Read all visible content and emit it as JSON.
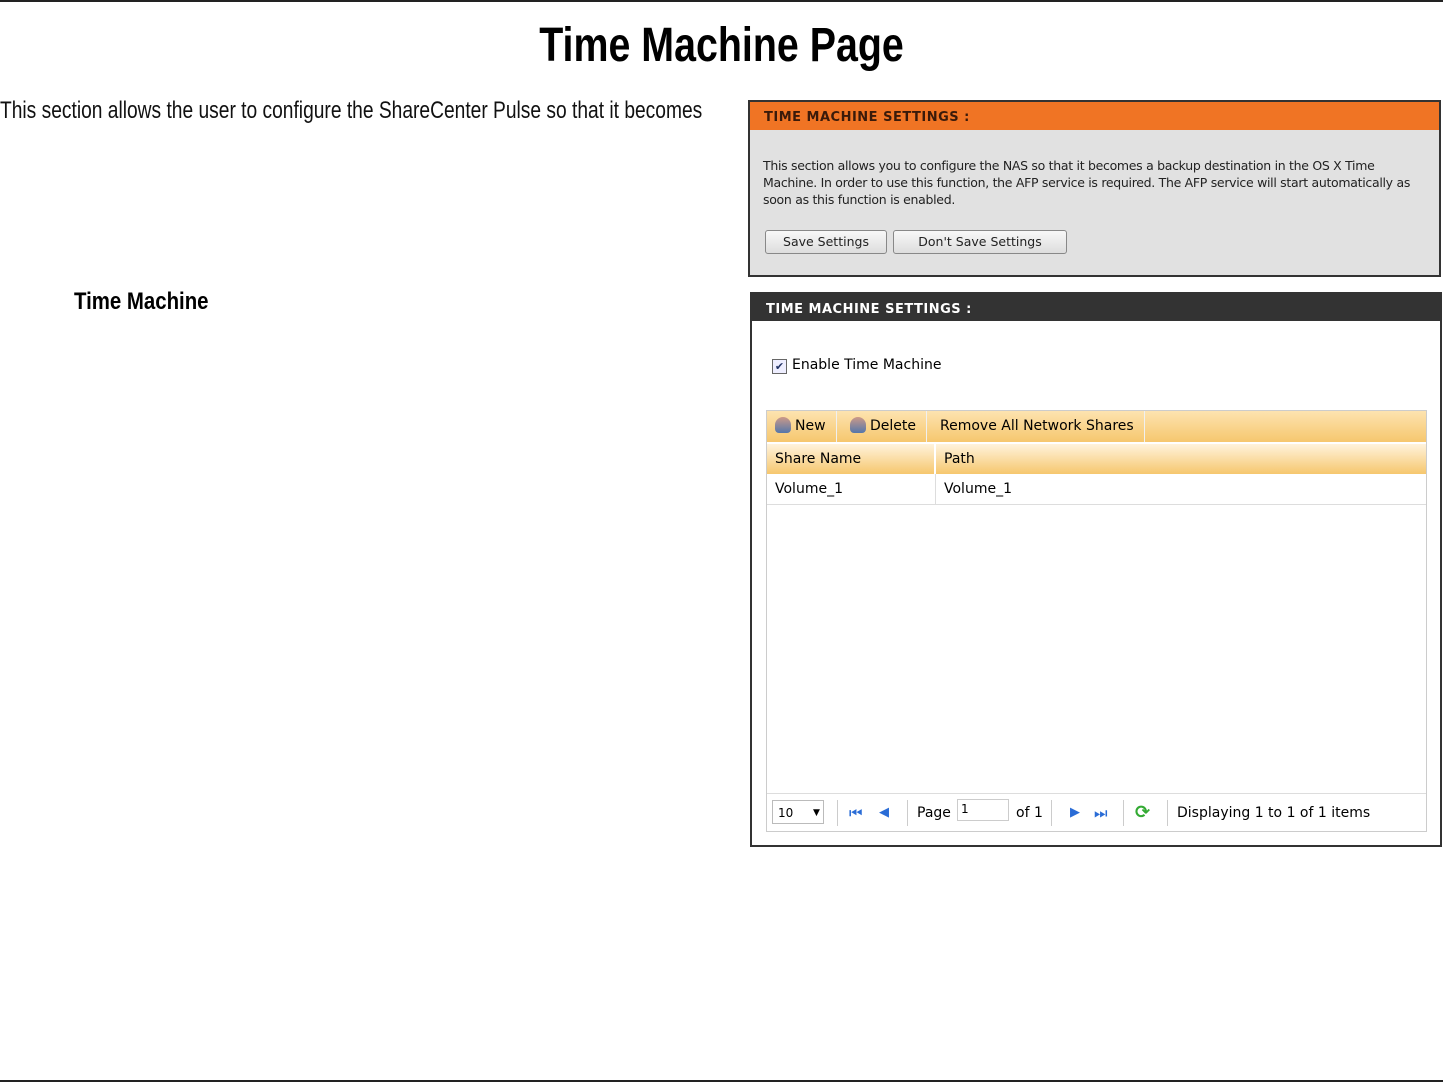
{
  "page": {
    "title": "Time Machine Page",
    "intro": "This section allows the user to configure the ShareCenter Pulse so that it becomes",
    "section_heading": "Time Machine"
  },
  "panel1": {
    "header": "TIME MACHINE SETTINGS :",
    "description": "This section allows you to configure the NAS so that it becomes a backup destination in the OS X Time Machine. In order to use this function, the AFP service is required. The AFP service will start automatically as soon as this function is enabled.",
    "save_label": "Save Settings",
    "dont_save_label": "Don't Save Settings"
  },
  "panel2": {
    "header": "TIME MACHINE SETTINGS :",
    "enable_label": "Enable Time Machine",
    "enable_checked": true,
    "toolbar": {
      "new": "New",
      "delete": "Delete",
      "remove_all": "Remove All Network Shares"
    },
    "columns": [
      "Share Name",
      "Path"
    ],
    "rows": [
      [
        "Volume_1",
        "Volume_1"
      ]
    ],
    "pager": {
      "page_size": "10",
      "page_label": "Page",
      "page_value": "1",
      "of_label": "of 1",
      "status": "Displaying 1 to 1 of 1 items"
    }
  },
  "colors": {
    "orange": "#f07424",
    "dark": "#333333"
  }
}
